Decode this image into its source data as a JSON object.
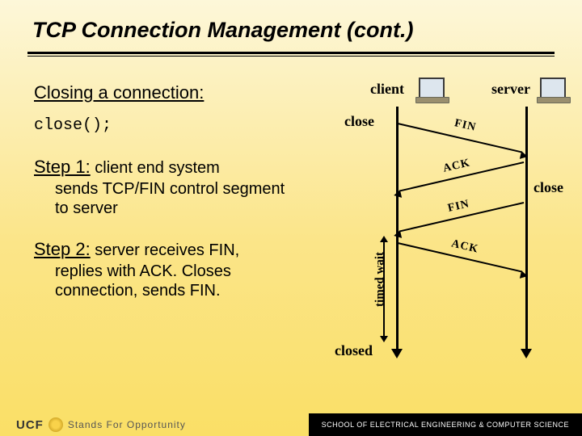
{
  "title": "TCP Connection Management (cont.)",
  "subhead": "Closing a connection:",
  "code_line": "close();",
  "steps": [
    {
      "head": "Step 1:",
      "rest": " client end system",
      "body": "sends TCP/FIN control segment to server"
    },
    {
      "head": "Step 2:",
      "rest": " server receives FIN,",
      "body": "replies with ACK. Closes connection, sends FIN."
    }
  ],
  "diagram": {
    "client_label": "client",
    "server_label": "server",
    "close_top": "close",
    "close_right": "close",
    "closed": "closed",
    "timed_wait": "timed wait",
    "msgs": [
      "FIN",
      "ACK",
      "FIN",
      "ACK"
    ]
  },
  "footer": {
    "ucf": "UCF",
    "tagline": "Stands For Opportunity",
    "school": "SCHOOL OF ELECTRICAL ENGINEERING & COMPUTER SCIENCE"
  }
}
